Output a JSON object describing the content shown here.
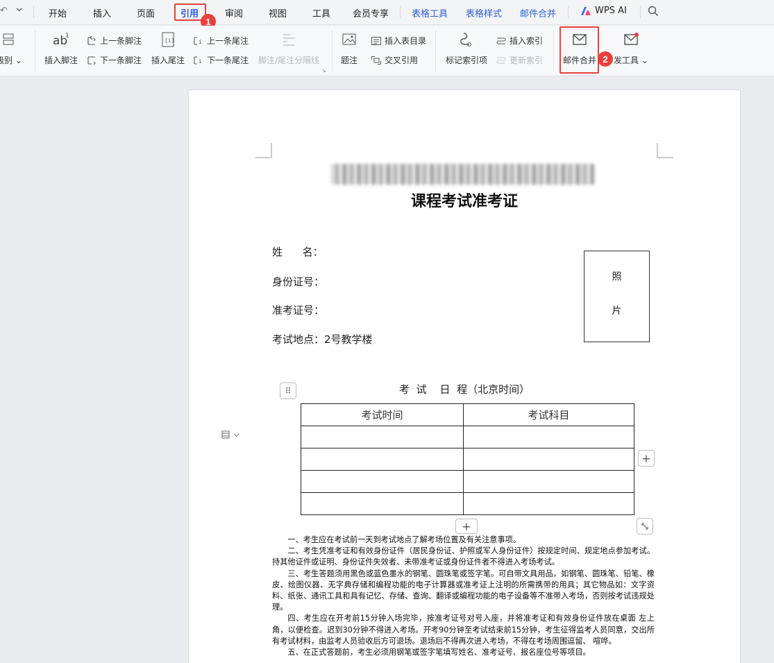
{
  "menubar": {
    "items": [
      {
        "label": "开始"
      },
      {
        "label": "插入"
      },
      {
        "label": "页面"
      },
      {
        "label": "引用"
      },
      {
        "label": "审阅"
      },
      {
        "label": "视图"
      },
      {
        "label": "工具"
      },
      {
        "label": "会员专享"
      },
      {
        "label": "表格工具"
      },
      {
        "label": "表格样式"
      },
      {
        "label": "邮件合并"
      },
      {
        "label": "WPS AI"
      }
    ],
    "active": "引用"
  },
  "annotations": {
    "step1": "1",
    "step2": "2"
  },
  "ribbon": {
    "level_label": "级别",
    "insert_footnote": "插入脚注",
    "prev_footnote": "上一条脚注",
    "next_footnote": "下一条脚注",
    "insert_endnote": "插入尾注",
    "prev_endnote": "上一条尾注",
    "next_endnote": "下一条尾注",
    "footnote_separator": "脚注/尾注分隔线",
    "caption": "题注",
    "insert_table_of_figures": "插入表目录",
    "cross_reference": "交叉引用",
    "mark_index_entry": "标记索引项",
    "insert_index": "插入索引",
    "update_index": "更新索引",
    "mail_merge": "邮件合并",
    "dev_tools": "发工具"
  },
  "document": {
    "title": "课程考试准考证",
    "fields": {
      "name": "姓      名：",
      "id_number": "身份证号：",
      "exam_number": "准考证号：",
      "location": "考试地点：2号教学楼"
    },
    "photo": {
      "char1": "照",
      "char2": "片"
    },
    "schedule": {
      "title": "考  试    日  程（北京时间）",
      "headers": [
        "考试时间",
        "考试科目"
      ]
    },
    "rules": [
      "一、考生应在考试前一天到考试地点了解考场位置及有关注意事项。",
      "二、考生凭准考证和有效身份证件（居民身份证、护照或军人身份证件）按规定时间、规定地点参加考试。持其他证件或证明、身份证件失效者、未带准考证或身份证件者不得进入考场考试。",
      "三、考生答题须用黑色或蓝色墨水的钢笔、圆珠笔或签字笔。可自带文具用品，如钢笔、圆珠笔、铅笔、橡皮、绘图仪器、无字典存储和编程功能的电子计算器或准考证上注明的所需携带的用具；其它物品如：文字资料、纸张、通讯工具和具有记忆、存储、查询、翻译或编程功能的电子设备等不准带入考场，否则按考试违规处理。",
      "四、考生应在开考前15分钟入场完毕，按准考证号对号入座，并将准考证和有效身份证件放在桌面 左上角，以便检查。迟到30分钟不得进入考场。开考90分钟至考试结束前15分钟，考生征得监考人员同意，交出所有考试材料，由监考人员验收后方可退场。退场后不得再次进入考场，不得在考场周围逗留、 喧哗。",
      "五、在正式答题前，考生必须用钢笔或签字笔填写姓名、准考证号、报名座位号等项目。"
    ]
  }
}
